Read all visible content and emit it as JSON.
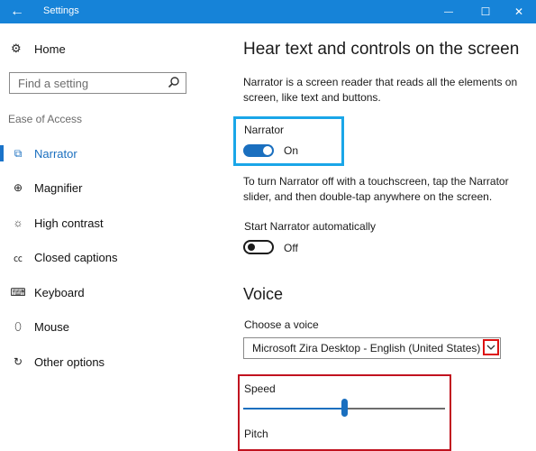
{
  "window": {
    "title": "Settings",
    "back_glyph": "←",
    "minimize_glyph": "—",
    "maximize_glyph": "☐",
    "close_glyph": "✕"
  },
  "sidebar": {
    "home_label": "Home",
    "search_placeholder": "Find a setting",
    "section_title": "Ease of Access",
    "items": [
      {
        "label": "Narrator",
        "icon": "narrator-icon",
        "glyph": "⧉",
        "active": true
      },
      {
        "label": "Magnifier",
        "icon": "magnifier-icon",
        "glyph": "⊕",
        "active": false
      },
      {
        "label": "High contrast",
        "icon": "high-contrast-icon",
        "glyph": "☼",
        "active": false
      },
      {
        "label": "Closed captions",
        "icon": "closed-captions-icon",
        "glyph": "㏄",
        "active": false
      },
      {
        "label": "Keyboard",
        "icon": "keyboard-icon",
        "glyph": "⌨",
        "active": false
      },
      {
        "label": "Mouse",
        "icon": "mouse-icon",
        "glyph": "⬯",
        "active": false
      },
      {
        "label": "Other options",
        "icon": "other-options-icon",
        "glyph": "↻",
        "active": false
      }
    ]
  },
  "main": {
    "heading": "Hear text and controls on the screen",
    "description": "Narrator is a screen reader that reads all the elements on screen, like text and buttons.",
    "narrator": {
      "label": "Narrator",
      "state": "On"
    },
    "touch_help": "To turn Narrator off with a touchscreen, tap the Narrator slider, and then double-tap anywhere on the screen.",
    "auto_start": {
      "label": "Start Narrator automatically",
      "state": "Off"
    },
    "voice_heading": "Voice",
    "choose_voice_label": "Choose a voice",
    "voice_selected": "Microsoft Zira Desktop - English (United States)",
    "speed_label": "Speed",
    "speed_value": 0.5,
    "pitch_label": "Pitch"
  },
  "colors": {
    "titlebar": "#1683d8",
    "accent": "#1a6fbf",
    "highlight_blue": "#1aa6e8",
    "highlight_red": "#c1121f"
  }
}
